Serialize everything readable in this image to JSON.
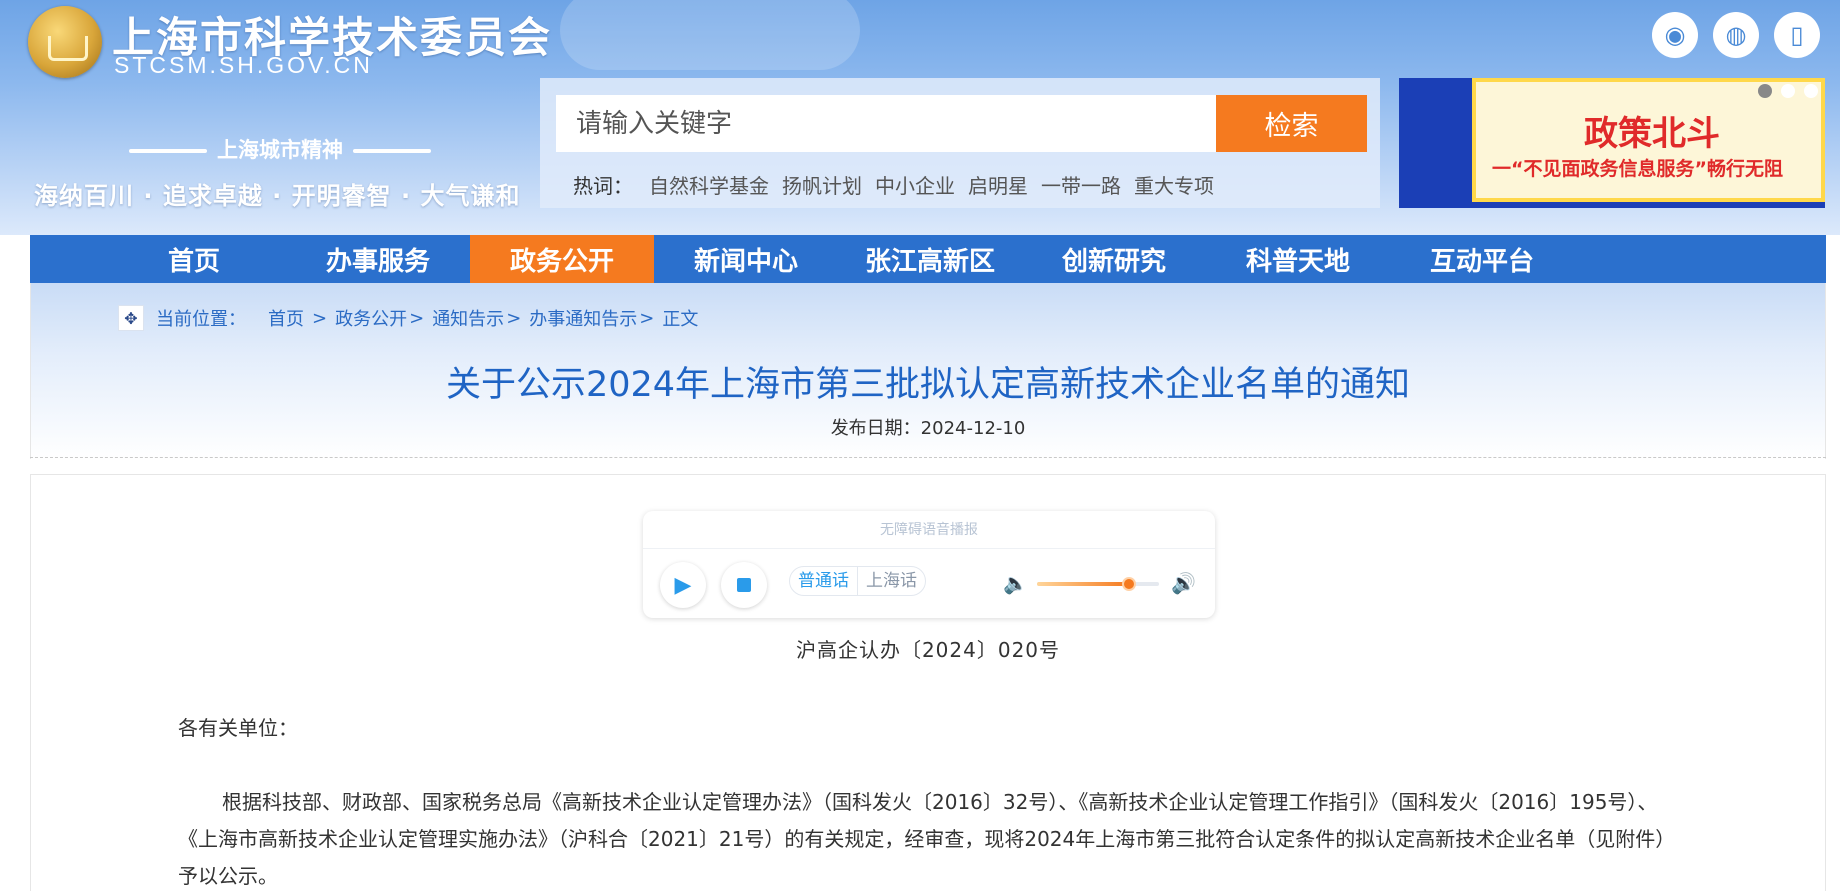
{
  "header": {
    "site_name": "上海市科学技术委员会",
    "site_domain": "STCSM.SH.GOV.CN",
    "spirit_title": "上海城市精神",
    "spirit_text": "海纳百川 · 追求卓越 · 开明睿智 · 大气谦和",
    "social_icons": [
      "weibo-icon",
      "wechat-icon",
      "mobile-icon"
    ]
  },
  "search": {
    "placeholder": "请输入关键字",
    "button_label": "检索",
    "hot_label": "热词：",
    "hot_words": [
      "自然科学基金",
      "扬帆计划",
      "中小企业",
      "启明星",
      "一带一路",
      "重大专项"
    ]
  },
  "banner": {
    "title": "政策北斗",
    "subtitle": "一“不见面政务信息服务”畅行无阻"
  },
  "nav": {
    "items": [
      "首页",
      "办事服务",
      "政务公开",
      "新闻中心",
      "张江高新区",
      "创新研究",
      "科普天地",
      "互动平台"
    ],
    "active": "政务公开"
  },
  "breadcrumb": {
    "label": "当前位置：",
    "items": [
      "首页",
      "政务公开",
      "通知告示",
      "办事通知告示",
      "正文"
    ]
  },
  "article": {
    "title": "关于公示2024年上海市第三批拟认定高新技术企业名单的通知",
    "publish_date": "发布日期：2024-12-10",
    "doc_number": "沪高企认办〔2024〕020号",
    "salutation": "各有关单位：",
    "paragraph": "根据科技部、财政部、国家税务总局《高新技术企业认定管理办法》（国科发火〔2016〕32号）、《高新技术企业认定管理工作指引》（国科发火〔2016〕195号）、《上海市高新技术企业认定管理实施办法》（沪科合〔2021〕21号）的有关规定，经审查，现将2024年上海市第三批符合认定条件的拟认定高新技术企业名单（见附件）予以公示。"
  },
  "player": {
    "title": "无障碍语音播报",
    "languages": [
      "普通话",
      "上海话"
    ],
    "active_language": "普通话",
    "volume": 0.75
  },
  "colors": {
    "nav_blue": "#2b70cd",
    "accent_orange": "#f57a1f",
    "title_blue": "#1f64c4"
  }
}
